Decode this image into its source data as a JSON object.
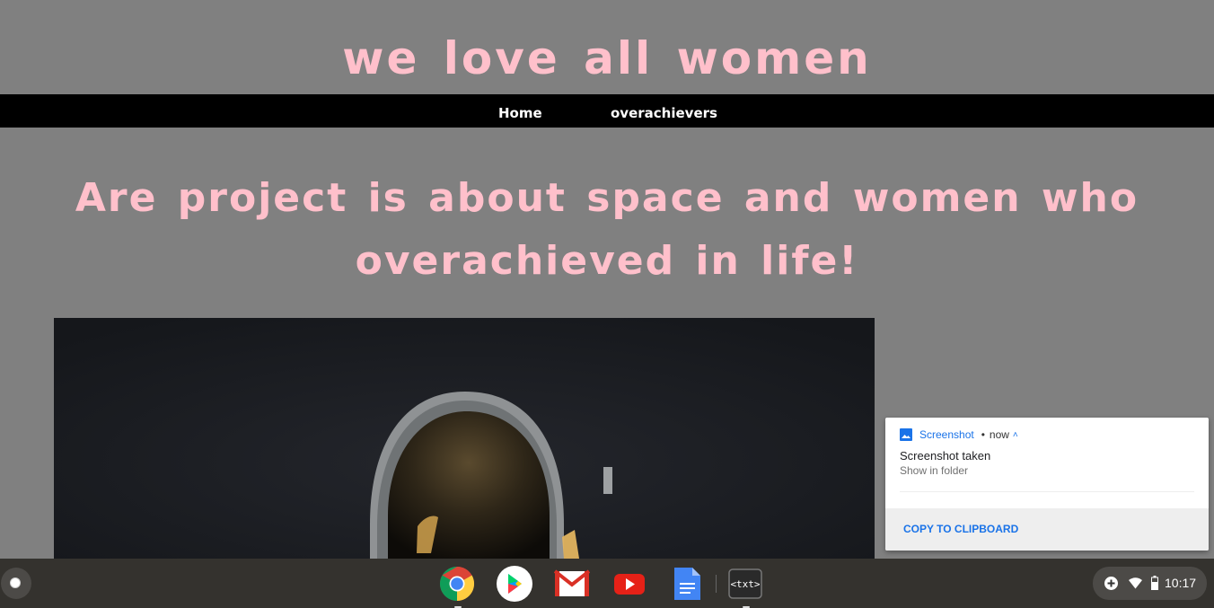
{
  "site": {
    "title": "we love all women",
    "nav": {
      "home": "Home",
      "overachievers": "overachievers"
    },
    "headline": "Are project is about space and women who overachieved in life!"
  },
  "notification": {
    "app_name": "Screenshot",
    "separator": "•",
    "time": "now",
    "title": "Screenshot taken",
    "subtitle": "Show in folder",
    "action": "COPY TO CLIPBOARD"
  },
  "shelf": {
    "apps": [
      "chrome-icon",
      "play-store-icon",
      "gmail-icon",
      "youtube-icon",
      "docs-icon",
      "text-editor-icon"
    ],
    "text_app_label": "<txt>",
    "clock": "10:17"
  },
  "colors": {
    "page_bg": "#808080",
    "title_pink": "#ffc0cb",
    "nav_bg": "#000000",
    "link_blue": "#1a73e8"
  }
}
